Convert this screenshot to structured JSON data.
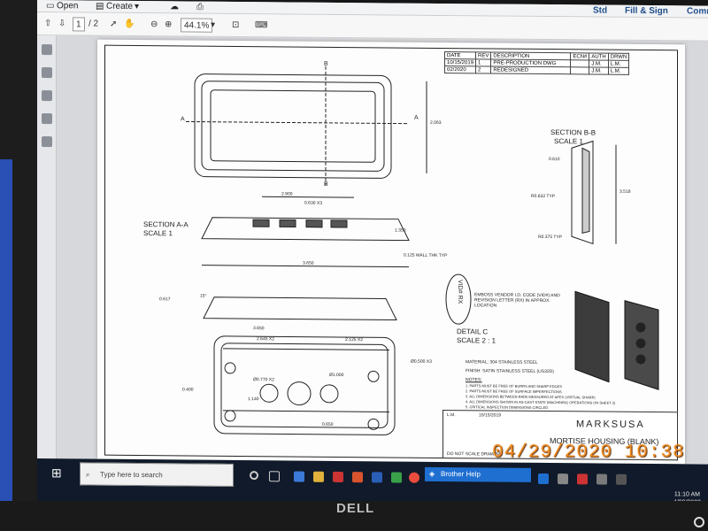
{
  "toolbar": {
    "open": "Open",
    "create": "Create",
    "std": "Std",
    "fill_sign": "Fill & Sign",
    "comment": "Comm",
    "page_current": "1",
    "page_total": "/ 2",
    "zoom": "44.1%"
  },
  "drawing": {
    "revision_table": {
      "headers": [
        "DATE",
        "REV",
        "DESCRIPTION",
        "ECN#",
        "AUTH",
        "DRWN"
      ],
      "rows": [
        [
          "10/15/2019",
          "1",
          "PRE-PRODUCTION DWG",
          "",
          "J.M.",
          "L.M."
        ],
        [
          "02/2020",
          "2",
          "REDESIGNED",
          "",
          "J.M.",
          "L.M."
        ]
      ]
    },
    "section_bb": "SECTION B-B",
    "section_bb_scale": "SCALE 1",
    "section_aa": "SECTION A-A",
    "section_aa_scale": "SCALE 1",
    "detail_c": "DETAIL C",
    "detail_c_scale": "SCALE 2 : 1",
    "labels": {
      "b_top": "B",
      "b_bottom": "B",
      "a_left": "A",
      "a_right": "A",
      "dim_2063": "2.063",
      "dim_3518": "3.518",
      "dim_610": "0.610",
      "r632": "R0.632 TYP",
      "r375": "R0.375 TYP",
      "wall": "0.125 WALL THK TYP",
      "dim_1350": "1.350",
      "dim_2900": "2.900",
      "dim_630": "0.630 X3",
      "dim_3650": "3.650",
      "dim_2645": "2.645 X2",
      "dim_2125": "2.125 X2",
      "dim_500": "Ø0.500 X3",
      "dim_1000": "Ø1.000",
      "dim_770": "Ø0.770 X2",
      "dim_1140": "1.140",
      "dim_0400": "0.400",
      "dim_0650": "0.650",
      "angle": "15°",
      "dim_0617": "0.617",
      "emboss": "EMBOSS VENDOR I.D. CODE (VID#) AND REVISION LETTER (RX) IN APPROX. LOCATION",
      "vid": "VID# RX"
    },
    "notes": {
      "material": "MATERIAL: 304 STAINLESS STEEL",
      "finish": "FINISH: SATIN STAINLESS STEEL (US32D)",
      "notes_title": "NOTES:",
      "n1": "1. PARTS MUST BE FREE OF BURRS AND SHARP EDGES",
      "n2": "2. PARTS MUST BE FREE OF SURFACE IMPERFECTIONS",
      "n3": "3. ALL DIMENSIONS BETWEEN RADII MEASURED AT APEX (VIRTUAL SHARP)",
      "n4": "4. ALL DIMENSIONS SHOWN IN AS-CAST STATE (MACHINING OPERATIONS ON SHEET 2)",
      "n5": "5. CRITICAL INSPECTION DIMENSIONS CIRCLED"
    },
    "title_block": {
      "company": "MARKSUSA",
      "title": "MORTISE HOUSING (BLANK)",
      "drawn": "L.M.",
      "date": "10/15/2019",
      "do_not_scale": "DO NOT SCALE DRAWING"
    }
  },
  "taskbar": {
    "search_placeholder": "Type here to search",
    "helper": "Brother Help",
    "time": "11:10 AM",
    "date": "4/29/2020"
  },
  "monitor": {
    "brand": "DELL",
    "timestamp": "04/29/2020 10:38"
  }
}
